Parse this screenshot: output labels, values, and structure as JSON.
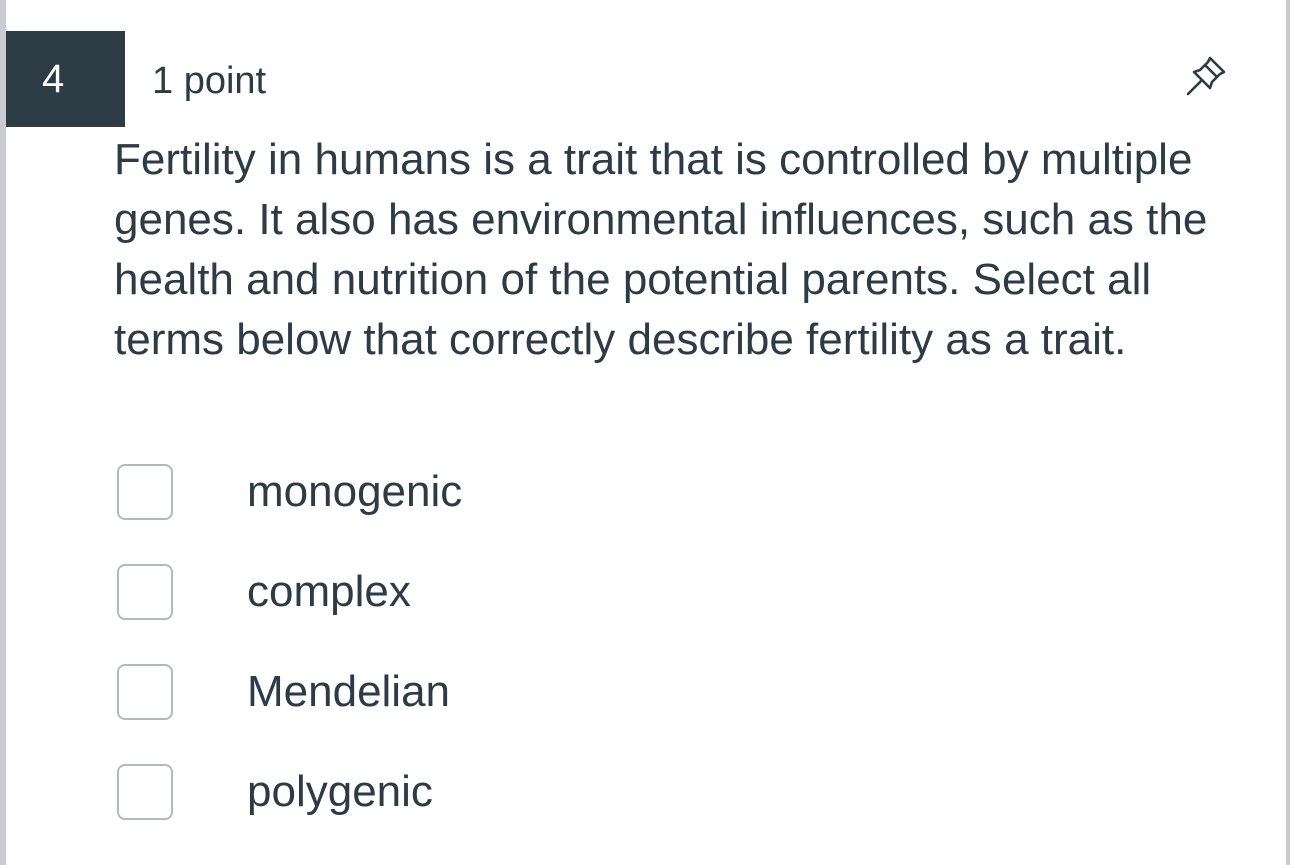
{
  "question": {
    "number": "4",
    "points": "1 point",
    "text": "Fertility in humans is a trait that is controlled by multiple genes. It also has environmental influences, such as the health and nutrition of the potential parents. Select all terms below that correctly describe fertility as a trait."
  },
  "pin": {
    "icon": "pin-icon"
  },
  "answers": [
    {
      "label": "monogenic",
      "checked": false
    },
    {
      "label": "complex",
      "checked": false
    },
    {
      "label": "Mendelian",
      "checked": false
    },
    {
      "label": "polygenic",
      "checked": false
    }
  ],
  "colors": {
    "header_bg": "#2d3b45",
    "text": "#2d3b45",
    "checkbox_border": "#b4b9be",
    "side_border": "#c9cdd1"
  }
}
